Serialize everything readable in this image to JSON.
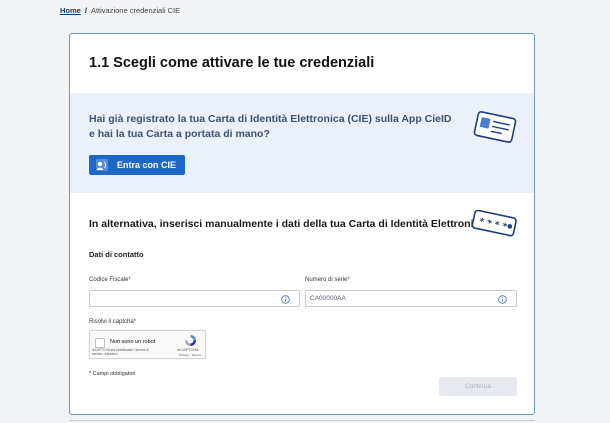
{
  "breadcrumb": {
    "home": "Home",
    "separator": "/",
    "current": "Attivazione credenziali CIE"
  },
  "card": {
    "title": "1.1 Scegli come attivare le tue credenziali",
    "cie_question": "Hai già registrato la tua Carta di Identità Elettronica (CIE) sulla App CieID e hai la tua Carta a portata di mano?",
    "cie_button_label": "Entra con CIE",
    "alt_heading": "In alternativa, inserisci manualmente i dati della tua Carta di Identità Elettronica",
    "pin_icon_text": "* * * *",
    "section_label": "Dati di contatto",
    "fields": {
      "codice_fiscale": {
        "label": "Codice Fiscale*",
        "value": "",
        "placeholder": ""
      },
      "numero_serie": {
        "label": "Numero di serie*",
        "value": "",
        "placeholder": "CA00000AA"
      }
    },
    "captcha_label": "Risolvi il captcha*",
    "recaptcha": {
      "checkbox_label": "Non sono un robot",
      "note": "reCAPTCHA sta modificando i termini di servizio. Intervieni",
      "brand": "reCAPTCHA",
      "links": "Privacy - Termini"
    },
    "required_note": "* Campi obbligatori",
    "submit_label": "Continua"
  },
  "colors": {
    "primary": "#1f66c9",
    "band": "#eaf1fb",
    "border": "#6f95c8"
  }
}
